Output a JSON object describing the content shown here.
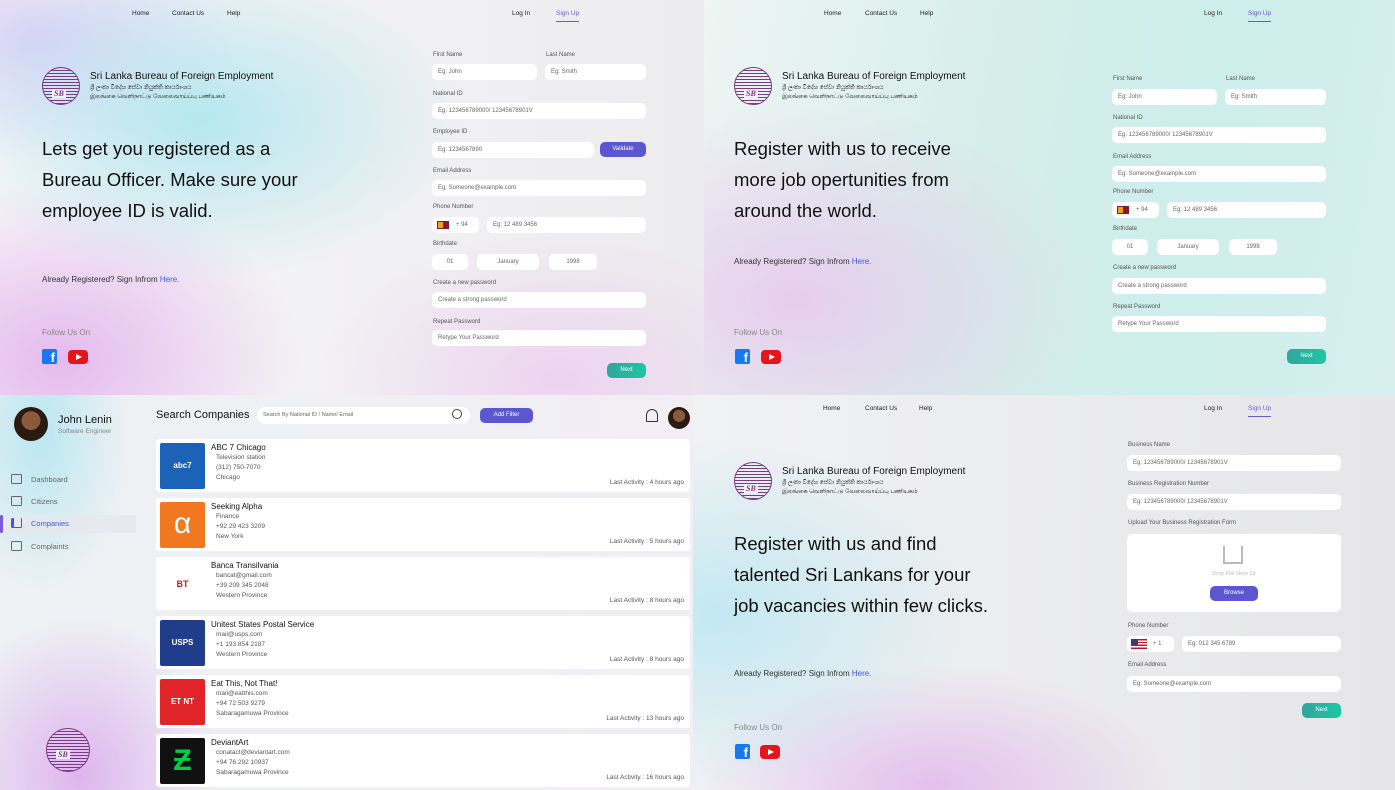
{
  "nav": {
    "home": "Home",
    "contact": "Contact Us",
    "help": "Help",
    "login": "Log In",
    "signup": "Sign Up"
  },
  "org": {
    "name": "Sri Lanka Bureau of Foreign Employment",
    "sinhala": "ශ්‍රී ලංකා විදේශ සේවා නියුක්ති කාර්යාංශය",
    "tamil": "இலங்கை வெளிநாட்டு வேலைவாய்ப்பு பணியகம்",
    "logo_text": "SBFE"
  },
  "common": {
    "already": "Already Registered? Sign Infrom ",
    "here": "Here.",
    "follow": "Follow Us On",
    "next": "Next"
  },
  "officer": {
    "headline": [
      "Lets get you registered as a",
      "Bureau Officer. Make sure your",
      "employee ID is valid."
    ],
    "first_name_label": "First Name",
    "first_name_placeholder": "Eg: John",
    "last_name_label": "Last Name",
    "last_name_placeholder": "Eg: Smith",
    "nid_label": "National ID",
    "nid_placeholder": "Eg: 123456789000/ 12345678901V",
    "emp_label": "Employee ID",
    "emp_placeholder": "Eg: 1234567890",
    "validate": "Validate",
    "email_label": "Email Address",
    "email_placeholder": "Eg: Someone@example.com",
    "phone_label": "Phone Number",
    "phone_code": "+ 94",
    "phone_placeholder": "Eg: 12 489 3456",
    "birth_label": "Birthdate",
    "day": "01",
    "month": "January",
    "year": "1998",
    "pw_label": "Create a new password",
    "pw_placeholder": "Create a strong password",
    "rpw_label": "Repeat Password",
    "rpw_placeholder": "Retype Your Password"
  },
  "citizen": {
    "headline": [
      "Register with us to receive",
      "more job opertunities from",
      "around the world."
    ],
    "first_name_label": "First Name",
    "first_name_placeholder": "Eg: John",
    "last_name_label": "Last Name",
    "last_name_placeholder": "Eg: Smith",
    "nid_label": "National ID",
    "nid_placeholder": "Eg: 123456789000/ 12345678901V",
    "email_label": "Email Address",
    "email_placeholder": "Eg: Someone@example.com",
    "phone_label": "Phone Number",
    "phone_code": "+ 94",
    "phone_placeholder": "Eg: 12 489 3456",
    "birth_label": "Birthdate",
    "day": "01",
    "month": "January",
    "year": "1998",
    "pw_label": "Create a new password",
    "pw_placeholder": "Create a strong password",
    "rpw_label": "Repeat Password",
    "rpw_placeholder": "Retype Your Password"
  },
  "dashboard": {
    "user_name": "John Lenin",
    "user_role": "Software Engineer",
    "title": "Search Companies",
    "search_placeholder": "Search By National ID / Name/ Email",
    "add_filter": "Add Filter",
    "menu": [
      {
        "label": "Dashboard"
      },
      {
        "label": "Citizens"
      },
      {
        "label": "Companies",
        "active": true
      },
      {
        "label": "Complaints"
      }
    ],
    "companies": [
      {
        "name": "ABC 7 Chicago",
        "l1": "Television station",
        "l2": "(312) 750-7070",
        "l3": "Chicago",
        "activity": "Last Activity : 4 hours ago",
        "logo": "abc7",
        "logo_text": "abc7 CHICAGO",
        "color": "#1c63b8"
      },
      {
        "name": "Seeking Alpha",
        "l1": "Finance",
        "l2": "+92 29 423 3209",
        "l3": "New York",
        "activity": "Last Activity : 5 hours ago",
        "logo": "alpha",
        "logo_text": "α",
        "color": "#f07820"
      },
      {
        "name": "Banca Transilvania",
        "l1": "bancat@gmail.com",
        "l2": "+39 209 345 2048",
        "l3": "Western Province",
        "activity": "Last Activity : 8 hours ago",
        "logo": "bt",
        "logo_text": "BT",
        "color": "#ffffff"
      },
      {
        "name": "Unitest States Postal Service",
        "l1": "mail@usps.com",
        "l2": "+1 193 854 2187",
        "l3": "Western Province",
        "activity": "Last Activity : 8 hours ago",
        "logo": "usps",
        "logo_text": "USPS",
        "color": "#1f3d8a"
      },
      {
        "name": "Eat This, Not That!",
        "l1": "mail@eatthis.com",
        "l2": "+94 72 503 9279",
        "l3": "Sabaragamuwa Province",
        "activity": "Last Activity : 13 hours ago",
        "logo": "etnt",
        "logo_text": "ET NT",
        "color": "#e0242a"
      },
      {
        "name": "DeviantArt",
        "l1": "conatact@deviantart.com",
        "l2": "+94 76 292 10937",
        "l3": "Sabaragamuwa Province",
        "activity": "Last Activity : 16 hours ago",
        "logo": "deviantart",
        "logo_text": "Ƶ",
        "color": "#111111"
      }
    ]
  },
  "company": {
    "headline": [
      "Register with us and find",
      "talented Sri Lankans for your",
      "job vacancies within few clicks."
    ],
    "bname_label": "Business Name",
    "bname_placeholder": "Eg: 123456789000/ 12345678901V",
    "breg_label": "Business Registration Number",
    "breg_placeholder": "Eg: 123456789000/ 12345678901V",
    "upload_label": "Upload Your Business Registration Form",
    "drop_text": "Drop File Here Or",
    "browse": "Browse",
    "phone_label": "Phone Number",
    "phone_code": "+ 1",
    "phone_placeholder": "Eg: 012 345 6789",
    "email_label": "Email Address",
    "email_placeholder": "Eg: Someone@example.com"
  },
  "colors": {
    "accent": "#5b57d1",
    "teal": "#24b2a1",
    "link": "#3b5bdb"
  }
}
